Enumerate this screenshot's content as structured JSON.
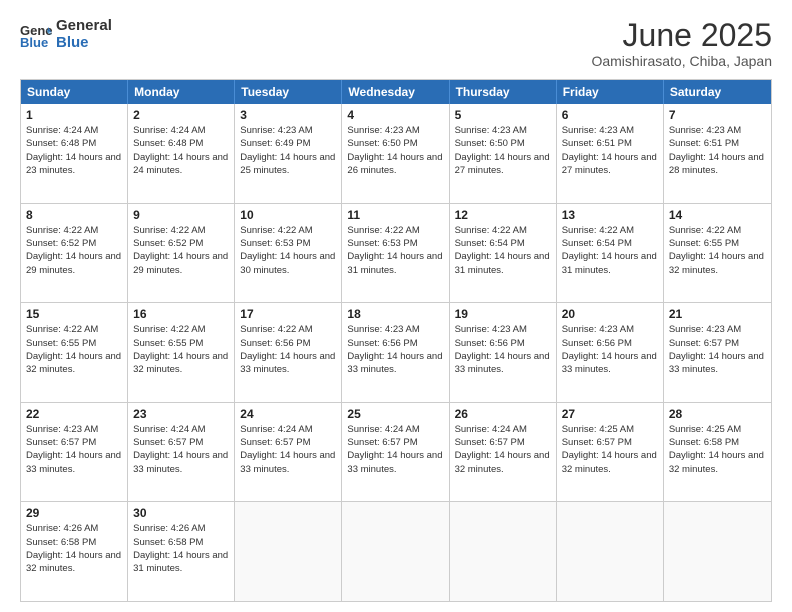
{
  "logo": {
    "general": "General",
    "blue": "Blue"
  },
  "title": "June 2025",
  "subtitle": "Oamishirasato, Chiba, Japan",
  "headers": [
    "Sunday",
    "Monday",
    "Tuesday",
    "Wednesday",
    "Thursday",
    "Friday",
    "Saturday"
  ],
  "weeks": [
    [
      {
        "day": "1",
        "sunrise": "4:24 AM",
        "sunset": "6:48 PM",
        "daylight": "14 hours and 23 minutes."
      },
      {
        "day": "2",
        "sunrise": "4:24 AM",
        "sunset": "6:48 PM",
        "daylight": "14 hours and 24 minutes."
      },
      {
        "day": "3",
        "sunrise": "4:23 AM",
        "sunset": "6:49 PM",
        "daylight": "14 hours and 25 minutes."
      },
      {
        "day": "4",
        "sunrise": "4:23 AM",
        "sunset": "6:50 PM",
        "daylight": "14 hours and 26 minutes."
      },
      {
        "day": "5",
        "sunrise": "4:23 AM",
        "sunset": "6:50 PM",
        "daylight": "14 hours and 27 minutes."
      },
      {
        "day": "6",
        "sunrise": "4:23 AM",
        "sunset": "6:51 PM",
        "daylight": "14 hours and 27 minutes."
      },
      {
        "day": "7",
        "sunrise": "4:23 AM",
        "sunset": "6:51 PM",
        "daylight": "14 hours and 28 minutes."
      }
    ],
    [
      {
        "day": "8",
        "sunrise": "4:22 AM",
        "sunset": "6:52 PM",
        "daylight": "14 hours and 29 minutes."
      },
      {
        "day": "9",
        "sunrise": "4:22 AM",
        "sunset": "6:52 PM",
        "daylight": "14 hours and 29 minutes."
      },
      {
        "day": "10",
        "sunrise": "4:22 AM",
        "sunset": "6:53 PM",
        "daylight": "14 hours and 30 minutes."
      },
      {
        "day": "11",
        "sunrise": "4:22 AM",
        "sunset": "6:53 PM",
        "daylight": "14 hours and 31 minutes."
      },
      {
        "day": "12",
        "sunrise": "4:22 AM",
        "sunset": "6:54 PM",
        "daylight": "14 hours and 31 minutes."
      },
      {
        "day": "13",
        "sunrise": "4:22 AM",
        "sunset": "6:54 PM",
        "daylight": "14 hours and 31 minutes."
      },
      {
        "day": "14",
        "sunrise": "4:22 AM",
        "sunset": "6:55 PM",
        "daylight": "14 hours and 32 minutes."
      }
    ],
    [
      {
        "day": "15",
        "sunrise": "4:22 AM",
        "sunset": "6:55 PM",
        "daylight": "14 hours and 32 minutes."
      },
      {
        "day": "16",
        "sunrise": "4:22 AM",
        "sunset": "6:55 PM",
        "daylight": "14 hours and 32 minutes."
      },
      {
        "day": "17",
        "sunrise": "4:22 AM",
        "sunset": "6:56 PM",
        "daylight": "14 hours and 33 minutes."
      },
      {
        "day": "18",
        "sunrise": "4:23 AM",
        "sunset": "6:56 PM",
        "daylight": "14 hours and 33 minutes."
      },
      {
        "day": "19",
        "sunrise": "4:23 AM",
        "sunset": "6:56 PM",
        "daylight": "14 hours and 33 minutes."
      },
      {
        "day": "20",
        "sunrise": "4:23 AM",
        "sunset": "6:56 PM",
        "daylight": "14 hours and 33 minutes."
      },
      {
        "day": "21",
        "sunrise": "4:23 AM",
        "sunset": "6:57 PM",
        "daylight": "14 hours and 33 minutes."
      }
    ],
    [
      {
        "day": "22",
        "sunrise": "4:23 AM",
        "sunset": "6:57 PM",
        "daylight": "14 hours and 33 minutes."
      },
      {
        "day": "23",
        "sunrise": "4:24 AM",
        "sunset": "6:57 PM",
        "daylight": "14 hours and 33 minutes."
      },
      {
        "day": "24",
        "sunrise": "4:24 AM",
        "sunset": "6:57 PM",
        "daylight": "14 hours and 33 minutes."
      },
      {
        "day": "25",
        "sunrise": "4:24 AM",
        "sunset": "6:57 PM",
        "daylight": "14 hours and 33 minutes."
      },
      {
        "day": "26",
        "sunrise": "4:24 AM",
        "sunset": "6:57 PM",
        "daylight": "14 hours and 32 minutes."
      },
      {
        "day": "27",
        "sunrise": "4:25 AM",
        "sunset": "6:57 PM",
        "daylight": "14 hours and 32 minutes."
      },
      {
        "day": "28",
        "sunrise": "4:25 AM",
        "sunset": "6:58 PM",
        "daylight": "14 hours and 32 minutes."
      }
    ],
    [
      {
        "day": "29",
        "sunrise": "4:26 AM",
        "sunset": "6:58 PM",
        "daylight": "14 hours and 32 minutes."
      },
      {
        "day": "30",
        "sunrise": "4:26 AM",
        "sunset": "6:58 PM",
        "daylight": "14 hours and 31 minutes."
      },
      {
        "day": "",
        "sunrise": "",
        "sunset": "",
        "daylight": ""
      },
      {
        "day": "",
        "sunrise": "",
        "sunset": "",
        "daylight": ""
      },
      {
        "day": "",
        "sunrise": "",
        "sunset": "",
        "daylight": ""
      },
      {
        "day": "",
        "sunrise": "",
        "sunset": "",
        "daylight": ""
      },
      {
        "day": "",
        "sunrise": "",
        "sunset": "",
        "daylight": ""
      }
    ]
  ]
}
